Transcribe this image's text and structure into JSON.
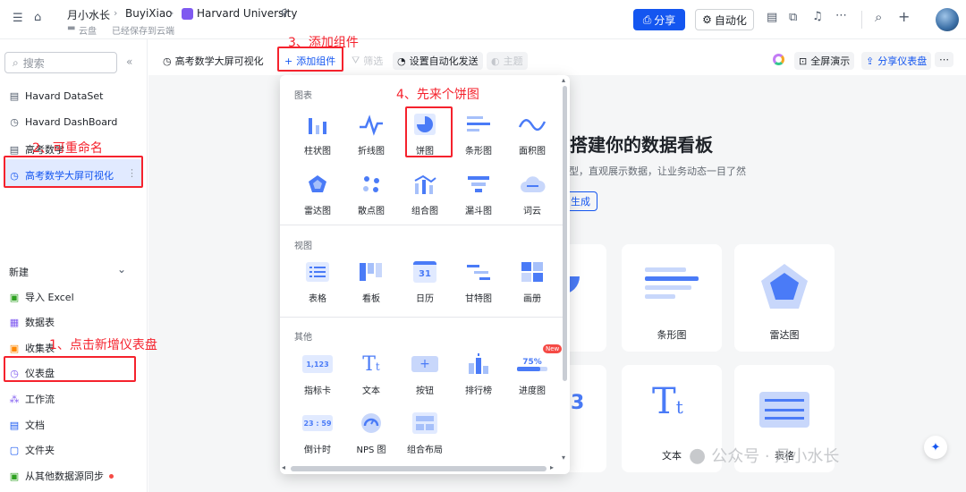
{
  "topbar": {
    "breadcrumb": [
      "月小水长",
      "BuyiXiao",
      "Harvard University"
    ],
    "location": "云盘",
    "save_status": "已经保存到云端",
    "share_label": "分享",
    "automation_label": "自动化",
    "more_glyph": "⋯"
  },
  "sidebar": {
    "search_placeholder": "搜索",
    "items": [
      {
        "label": "Havard DataSet",
        "icon": "table-icon"
      },
      {
        "label": "Havard DashBoard",
        "icon": "dashboard-icon"
      },
      {
        "label": "高考数学",
        "icon": "table-icon"
      },
      {
        "label": "高考数学大屏可视化",
        "icon": "dashboard-icon"
      }
    ],
    "new_label": "新建",
    "new_items": [
      {
        "label": "导入 Excel",
        "icon": "excel-icon"
      },
      {
        "label": "数据表",
        "icon": "table-icon"
      },
      {
        "label": "收集表",
        "icon": "form-icon"
      },
      {
        "label": "仪表盘",
        "icon": "dashboard-icon"
      },
      {
        "label": "工作流",
        "icon": "workflow-icon"
      },
      {
        "label": "文档",
        "icon": "doc-icon"
      },
      {
        "label": "文件夹",
        "icon": "folder-icon"
      },
      {
        "label": "从其他数据源同步",
        "icon": "sync-icon"
      }
    ]
  },
  "toolbar": {
    "title": "高考数学大屏可视化",
    "add_component": "添加组件",
    "filter": "筛选",
    "auto_send": "设置自动化发送",
    "theme": "主题",
    "fullscreen": "全屏演示",
    "share_dashboard": "分享仪表盘"
  },
  "canvas": {
    "hero_title": "搭建你的数据看板",
    "hero_sub": "型，直观展示数据，让业务动态一目了然",
    "hero_btn": "生成",
    "cards": [
      {
        "label": "条形图"
      },
      {
        "label": "雷达图"
      },
      {
        "label": "文本"
      },
      {
        "label": "表格"
      }
    ],
    "partial_number": "3"
  },
  "popup": {
    "sections": [
      {
        "title": "图表",
        "items": [
          "柱状图",
          "折线图",
          "饼图",
          "条形图",
          "面积图",
          "雷达图",
          "散点图",
          "组合图",
          "漏斗图",
          "词云"
        ]
      },
      {
        "title": "视图",
        "items": [
          "表格",
          "看板",
          "日历",
          "甘特图",
          "画册"
        ]
      },
      {
        "title": "其他",
        "items": [
          "指标卡",
          "文本",
          "按钮",
          "排行榜",
          "进度图",
          "倒计时",
          "NPS 图",
          "组合布局"
        ]
      }
    ],
    "metric_sample": "1,123",
    "calendar_sample": "31",
    "progress_sample": "75%",
    "countdown_sample": "23 : 59",
    "new_badge": "New"
  },
  "annotations": {
    "step1": "1、点击新增仪表盘",
    "step2": "2、可重命名",
    "step3": "3、添加组件",
    "step4": "4、先来个饼图"
  },
  "watermark": "公众号 · 月小水长",
  "colors": {
    "accent": "#1456f0",
    "annotation": "#f5222d",
    "icon_blue": "#4a7bf7"
  }
}
